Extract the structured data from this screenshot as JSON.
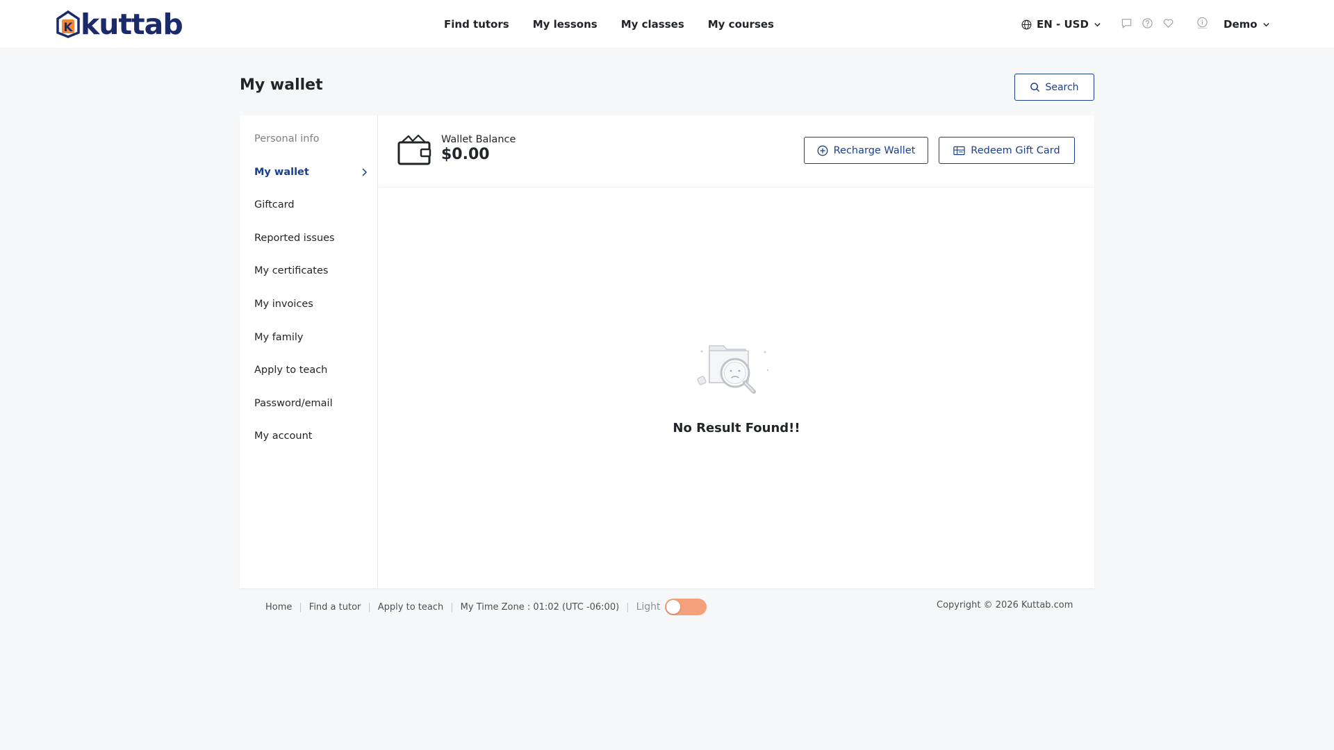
{
  "header": {
    "logo_text": "kuttab",
    "logo_letter": "K",
    "nav": [
      "Find tutors",
      "My lessons",
      "My classes",
      "My courses"
    ],
    "language_currency": "EN - USD",
    "user_name": "Demo"
  },
  "page": {
    "title": "My wallet",
    "search_label": "Search"
  },
  "sidebar": {
    "items": [
      {
        "label": "Personal info",
        "state": "muted"
      },
      {
        "label": "My wallet",
        "state": "active"
      },
      {
        "label": "Giftcard"
      },
      {
        "label": "Reported issues"
      },
      {
        "label": "My certificates"
      },
      {
        "label": "My invoices"
      },
      {
        "label": "My family"
      },
      {
        "label": "Apply to teach"
      },
      {
        "label": "Password/email"
      },
      {
        "label": "My account"
      }
    ]
  },
  "wallet": {
    "balance_label": "Wallet Balance",
    "balance_value": "$0.00",
    "recharge_label": "Recharge Wallet",
    "redeem_label": "Redeem Gift Card",
    "empty_text": "No Result Found!!"
  },
  "footer": {
    "links": [
      "Home",
      "Find a tutor",
      "Apply to teach"
    ],
    "timezone": "My Time Zone : 01:02 (UTC -06:00)",
    "theme_label": "Light",
    "copyright": "Copyright © 2026 Kuttab.com"
  },
  "colors": {
    "primary": "#1b3f8f",
    "logo": "#1b2a6b",
    "toggle": "#f4a07a",
    "background": "#f6f7f9"
  }
}
